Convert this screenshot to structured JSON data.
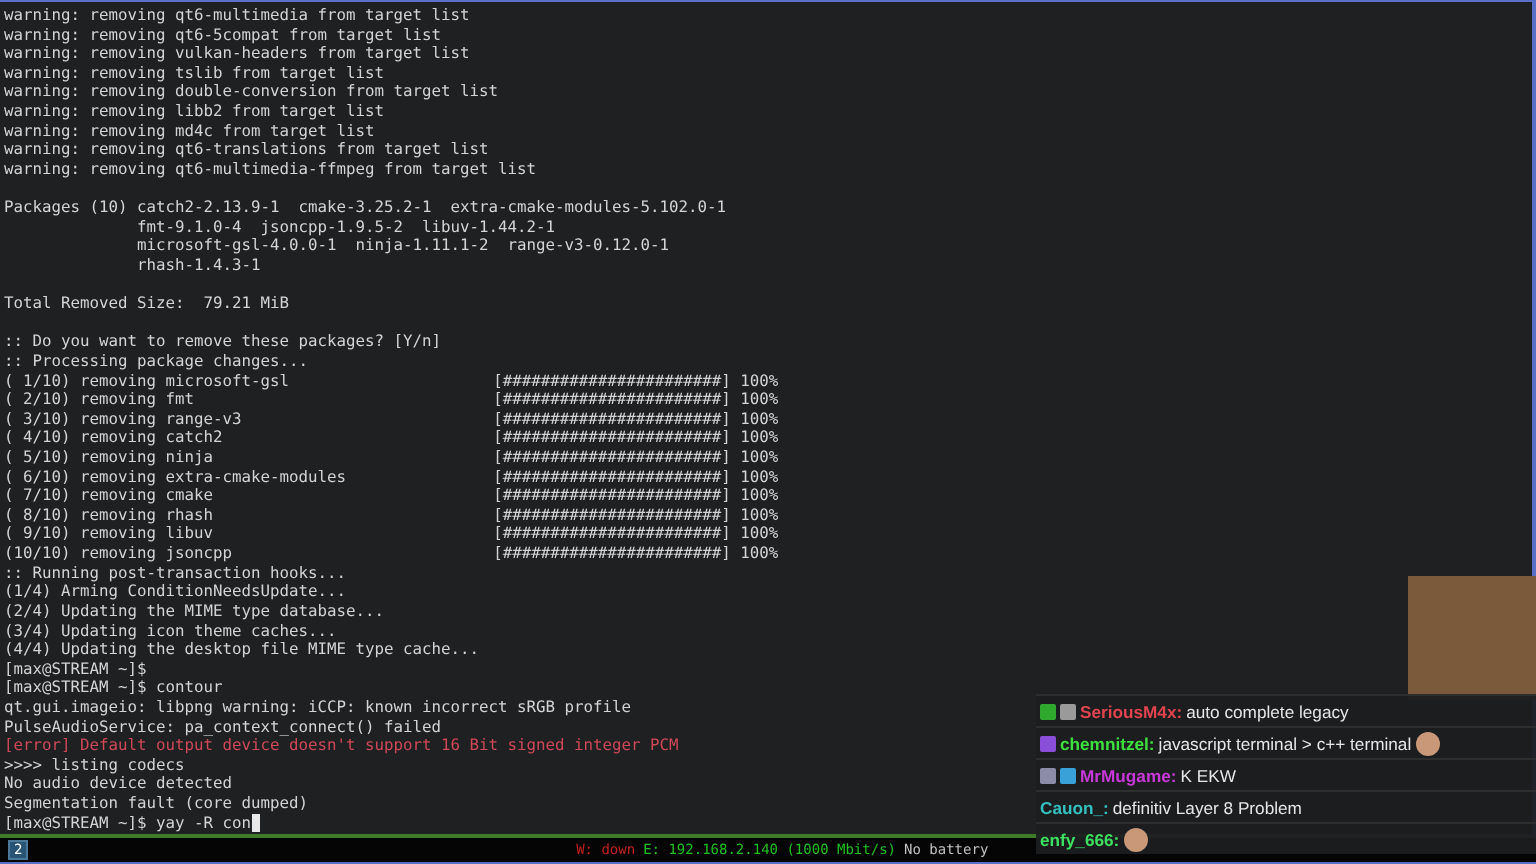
{
  "terminal": {
    "lines": [
      {
        "kind": "normal",
        "text": "warning: removing qt6-multimedia from target list"
      },
      {
        "kind": "normal",
        "text": "warning: removing qt6-5compat from target list"
      },
      {
        "kind": "normal",
        "text": "warning: removing vulkan-headers from target list"
      },
      {
        "kind": "normal",
        "text": "warning: removing tslib from target list"
      },
      {
        "kind": "normal",
        "text": "warning: removing double-conversion from target list"
      },
      {
        "kind": "normal",
        "text": "warning: removing libb2 from target list"
      },
      {
        "kind": "normal",
        "text": "warning: removing md4c from target list"
      },
      {
        "kind": "normal",
        "text": "warning: removing qt6-translations from target list"
      },
      {
        "kind": "normal",
        "text": "warning: removing qt6-multimedia-ffmpeg from target list"
      },
      {
        "kind": "blank"
      },
      {
        "kind": "normal",
        "text": "Packages (10) catch2-2.13.9-1  cmake-3.25.2-1  extra-cmake-modules-5.102.0-1"
      },
      {
        "kind": "normal",
        "text": "              fmt-9.1.0-4  jsoncpp-1.9.5-2  libuv-1.44.2-1"
      },
      {
        "kind": "normal",
        "text": "              microsoft-gsl-4.0.0-1  ninja-1.11.1-2  range-v3-0.12.0-1"
      },
      {
        "kind": "normal",
        "text": "              rhash-1.4.3-1"
      },
      {
        "kind": "blank"
      },
      {
        "kind": "normal",
        "text": "Total Removed Size:  79.21 MiB"
      },
      {
        "kind": "blank"
      },
      {
        "kind": "normal",
        "text": ":: Do you want to remove these packages? [Y/n]"
      },
      {
        "kind": "normal",
        "text": ":: Processing package changes..."
      },
      {
        "kind": "progress",
        "text": "( 1/10) removing microsoft-gsl",
        "bar": "[#######################]",
        "percent": "100%"
      },
      {
        "kind": "progress",
        "text": "( 2/10) removing fmt",
        "bar": "[#######################]",
        "percent": "100%"
      },
      {
        "kind": "progress",
        "text": "( 3/10) removing range-v3",
        "bar": "[#######################]",
        "percent": "100%"
      },
      {
        "kind": "progress",
        "text": "( 4/10) removing catch2",
        "bar": "[#######################]",
        "percent": "100%"
      },
      {
        "kind": "progress",
        "text": "( 5/10) removing ninja",
        "bar": "[#######################]",
        "percent": "100%"
      },
      {
        "kind": "progress",
        "text": "( 6/10) removing extra-cmake-modules",
        "bar": "[#######################]",
        "percent": "100%"
      },
      {
        "kind": "progress",
        "text": "( 7/10) removing cmake",
        "bar": "[#######################]",
        "percent": "100%"
      },
      {
        "kind": "progress",
        "text": "( 8/10) removing rhash",
        "bar": "[#######################]",
        "percent": "100%"
      },
      {
        "kind": "progress",
        "text": "( 9/10) removing libuv",
        "bar": "[#######################]",
        "percent": "100%"
      },
      {
        "kind": "progress",
        "text": "(10/10) removing jsoncpp",
        "bar": "[#######################]",
        "percent": "100%"
      },
      {
        "kind": "normal",
        "text": ":: Running post-transaction hooks..."
      },
      {
        "kind": "normal",
        "text": "(1/4) Arming ConditionNeedsUpdate..."
      },
      {
        "kind": "normal",
        "text": "(2/4) Updating the MIME type database..."
      },
      {
        "kind": "normal",
        "text": "(3/4) Updating icon theme caches..."
      },
      {
        "kind": "normal",
        "text": "(4/4) Updating the desktop file MIME type cache..."
      },
      {
        "kind": "normal",
        "text": "[max@STREAM ~]$"
      },
      {
        "kind": "normal",
        "text": "[max@STREAM ~]$ contour"
      },
      {
        "kind": "normal",
        "text": "qt.gui.imageio: libpng warning: iCCP: known incorrect sRGB profile"
      },
      {
        "kind": "normal",
        "text": "PulseAudioService: pa_context_connect() failed"
      },
      {
        "kind": "error",
        "text": "[error] Default output device doesn't support 16 Bit signed integer PCM"
      },
      {
        "kind": "normal",
        "text": ">>>> listing codecs"
      },
      {
        "kind": "normal",
        "text": "No audio device detected"
      },
      {
        "kind": "normal",
        "text": "Segmentation fault (core dumped)"
      },
      {
        "kind": "input",
        "text": "[max@STREAM ~]$ yay -R con"
      }
    ]
  },
  "chat": {
    "messages": [
      {
        "user": "SeriousM4x:",
        "color": "#e0444e",
        "text": "auto complete legacy",
        "badges": [
          {
            "color": "#2fa82f"
          },
          {
            "color": "#9a9a9a"
          }
        ],
        "emote": false
      },
      {
        "user": "chemnitzel:",
        "color": "#3ee03e",
        "text": "javascript terminal > c++ terminal",
        "badges": [
          {
            "color": "#8a4fd8"
          }
        ],
        "emote": true
      },
      {
        "user": "MrMugame:",
        "color": "#c838d8",
        "text": "K EKW",
        "badges": [
          {
            "color": "#8c8ca8"
          },
          {
            "color": "#3aa0d8"
          }
        ],
        "emote": false
      },
      {
        "user": "Cauon_:",
        "color": "#35c0c0",
        "text": "definitiv Layer 8 Problem",
        "emote": false
      },
      {
        "user": "enfy_666:",
        "color": "#3ee060",
        "emote": true
      }
    ]
  },
  "status_bar": {
    "workspaces": [
      {
        "label": "2",
        "selected": true
      }
    ],
    "items": [
      {
        "text": "W: down",
        "color": "#c02020"
      },
      {
        "text": "E: 192.168.2.140 (1000 Mbit/s)",
        "color": "#20c020"
      },
      {
        "text": "No battery",
        "color": "#c0c0c0"
      }
    ]
  }
}
